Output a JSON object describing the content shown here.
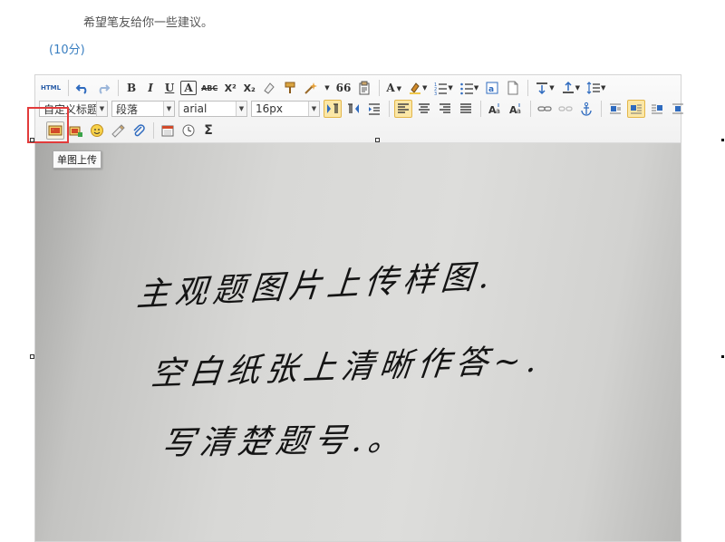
{
  "question": {
    "text": "希望笔友给你一些建议。",
    "score": "(10分)"
  },
  "toolbar": {
    "html_label": "HTML",
    "bold": "B",
    "italic": "I",
    "underline": "U",
    "frame_text": "A",
    "strike": "ABC",
    "superscript": "X²",
    "subscript": "X₂",
    "quote": "66",
    "font_color": "A",
    "combos": {
      "heading": "自定义标题",
      "paragraph": "段落",
      "font_family": "arial",
      "font_size": "16px"
    },
    "sigma": "Σ"
  },
  "tooltip": {
    "single_upload": "单图上传"
  },
  "content": {
    "lines": [
      "主观题图片上传样图.",
      "空白纸张上清晰作答~.",
      "写清楚题号.。"
    ]
  },
  "colors": {
    "score": "#3a7fc1",
    "highlight": "#e23b3b"
  }
}
